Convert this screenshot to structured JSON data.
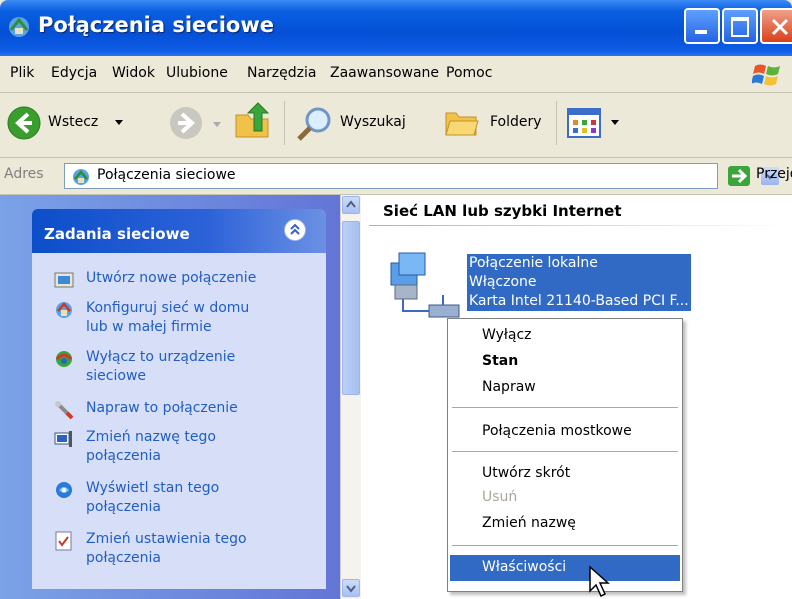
{
  "window": {
    "title": "Połączenia sieciowe",
    "colors": {
      "titlebar": "#0450d6",
      "selection": "#316ac5",
      "link": "#215dc6",
      "taskpane_bg": "#d6dff7"
    }
  },
  "menubar": {
    "items": [
      "Plik",
      "Edycja",
      "Widok",
      "Ulubione",
      "Narzędzia",
      "Zaawansowane",
      "Pomoc"
    ]
  },
  "toolbar": {
    "back_label": "Wstecz",
    "search_label": "Wyszukaj",
    "folders_label": "Foldery"
  },
  "addressbar": {
    "label": "Adres",
    "value": "Połączenia sieciowe",
    "go_label": "Przejdź"
  },
  "taskpane": {
    "title": "Zadania sieciowe",
    "items": [
      {
        "label": "Utwórz nowe połączenie",
        "icon": "new-connection-icon"
      },
      {
        "label": "Konfiguruj sieć w domu\nlub w małej firmie",
        "icon": "home-network-icon"
      },
      {
        "label": "Wyłącz to urządzenie\nsieciowe",
        "icon": "disable-device-icon"
      },
      {
        "label": "Napraw to połączenie",
        "icon": "repair-icon"
      },
      {
        "label": "Zmień nazwę tego\npołączenia",
        "icon": "rename-icon"
      },
      {
        "label": "Wyświetl stan tego\npołączenia",
        "icon": "status-icon"
      },
      {
        "label": "Zmień ustawienia tego\npołączenia",
        "icon": "settings-icon"
      }
    ]
  },
  "content": {
    "group_title": "Sieć LAN lub szybki Internet",
    "connection": {
      "name": "Połączenie lokalne",
      "status": "Włączone",
      "device": "Karta Intel 21140-Based PCI F..."
    }
  },
  "context_menu": {
    "items": [
      {
        "label": "Wyłącz",
        "style": "normal"
      },
      {
        "label": "Stan",
        "style": "bold"
      },
      {
        "label": "Napraw",
        "style": "normal"
      },
      {
        "label": "Połączenia mostkowe",
        "style": "normal"
      },
      {
        "label": "Utwórz skrót",
        "style": "normal"
      },
      {
        "label": "Usuń",
        "style": "disabled"
      },
      {
        "label": "Zmień nazwę",
        "style": "normal"
      },
      {
        "label": "Właściwości",
        "style": "selected"
      }
    ]
  }
}
